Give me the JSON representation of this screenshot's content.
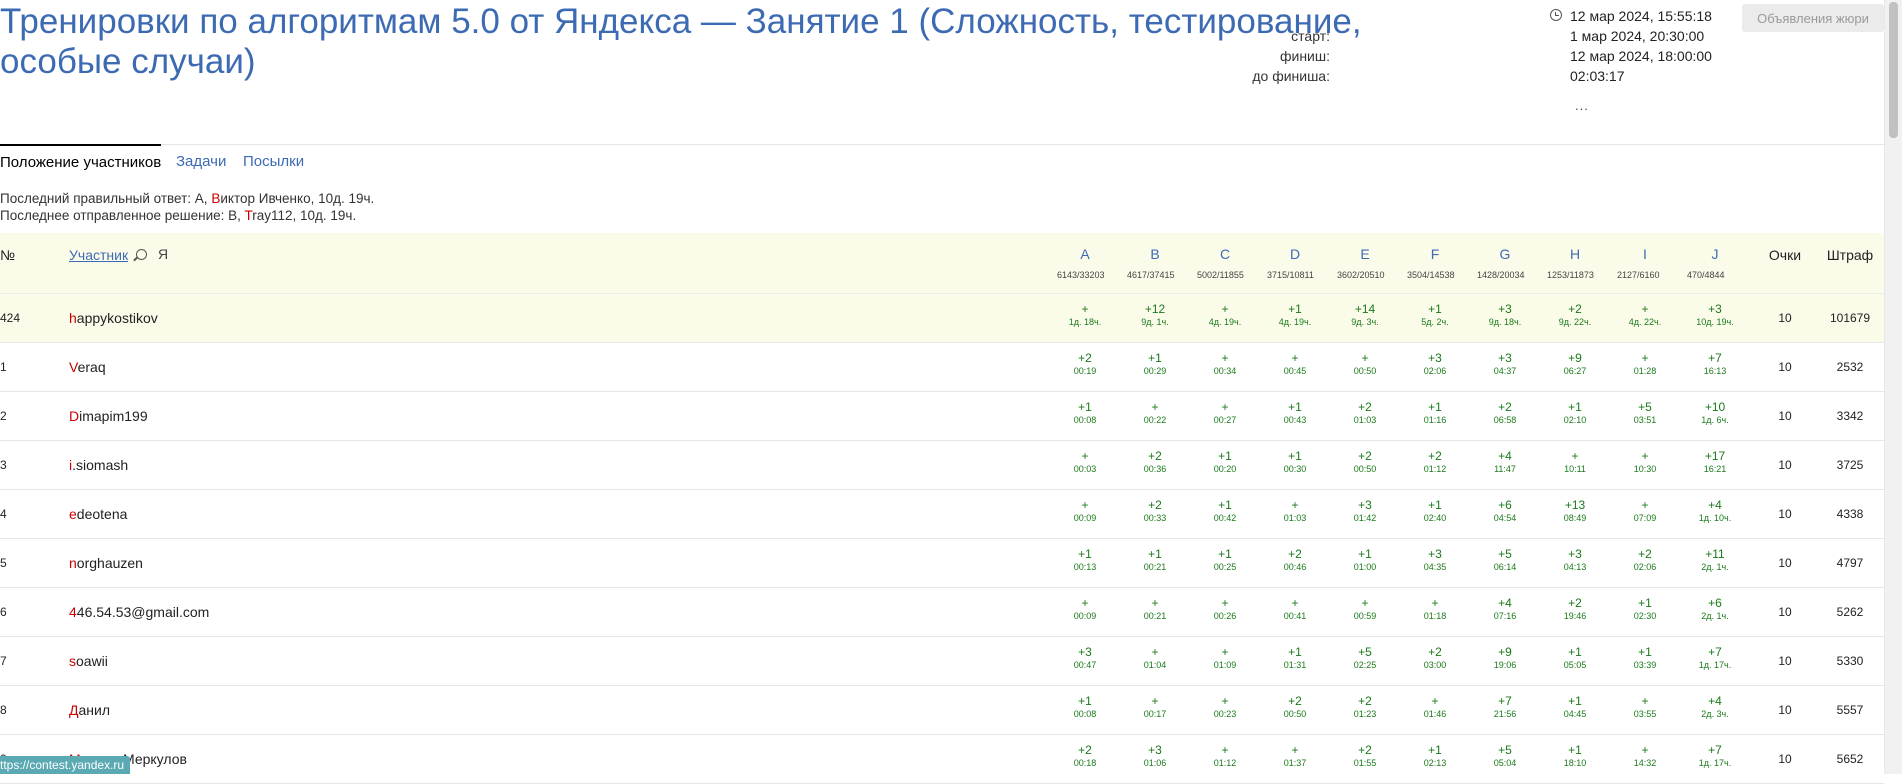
{
  "title": "Тренировки по алгоритмам 5.0 от Яндекса — Занятие 1 (Сложность, тестирование, особые случаи)",
  "meta": {
    "now": "12 мар 2024, 15:55:18",
    "start_label": "старт:",
    "start_value": "1 мар 2024, 20:30:00",
    "finish_label": "финиш:",
    "finish_value": "12 мар 2024, 18:00:00",
    "left_label": "до финиша:",
    "left_value": "02:03:17",
    "more": "..."
  },
  "announcements_button": "Объявления жюри",
  "tabs": [
    "Положение участников",
    "Задачи",
    "Посылки"
  ],
  "last_info": {
    "correct_label": "Последний правильный ответ:",
    "correct_problem": "A,",
    "correct_user_first": "В",
    "correct_user_rest": "иктор Ивченко,",
    "correct_time": "10д. 19ч.",
    "sent_label": "Последнее отправленное решение:",
    "sent_problem": "B,",
    "sent_user_first": "T",
    "sent_user_rest": "ray112,",
    "sent_time": "10д. 19ч."
  },
  "table": {
    "rank_header": "№",
    "name_header": "Участник",
    "me_label": "Я",
    "score_header": "Очки",
    "penalty_header": "Штраф",
    "problems": [
      {
        "letter": "A",
        "stat": "6143/33203"
      },
      {
        "letter": "B",
        "stat": "4617/37415"
      },
      {
        "letter": "C",
        "stat": "5002/11855"
      },
      {
        "letter": "D",
        "stat": "3715/10811"
      },
      {
        "letter": "E",
        "stat": "3602/20510"
      },
      {
        "letter": "F",
        "stat": "3504/14538"
      },
      {
        "letter": "G",
        "stat": "1428/20034"
      },
      {
        "letter": "H",
        "stat": "1253/11873"
      },
      {
        "letter": "I",
        "stat": "2127/6160"
      },
      {
        "letter": "J",
        "stat": "470/4844"
      }
    ],
    "rows": [
      {
        "rank": "424",
        "first": "h",
        "rest": "appykostikov",
        "score": "10",
        "penalty": "101679",
        "results": [
          [
            "+",
            "1д. 18ч."
          ],
          [
            "+12",
            "9д. 1ч."
          ],
          [
            "+",
            "4д. 19ч."
          ],
          [
            "+1",
            "4д. 19ч."
          ],
          [
            "+14",
            "9д. 3ч."
          ],
          [
            "+1",
            "5д. 2ч."
          ],
          [
            "+3",
            "9д. 18ч."
          ],
          [
            "+2",
            "9д. 22ч."
          ],
          [
            "+",
            "4д. 22ч."
          ],
          [
            "+3",
            "10д. 19ч."
          ]
        ]
      },
      {
        "rank": "1",
        "first": "V",
        "rest": "eraq",
        "score": "10",
        "penalty": "2532",
        "results": [
          [
            "+2",
            "00:19"
          ],
          [
            "+1",
            "00:29"
          ],
          [
            "+",
            "00:34"
          ],
          [
            "+",
            "00:45"
          ],
          [
            "+",
            "00:50"
          ],
          [
            "+3",
            "02:06"
          ],
          [
            "+3",
            "04:37"
          ],
          [
            "+9",
            "06:27"
          ],
          [
            "+",
            "01:28"
          ],
          [
            "+7",
            "16:13"
          ]
        ]
      },
      {
        "rank": "2",
        "first": "D",
        "rest": "imapim199",
        "score": "10",
        "penalty": "3342",
        "results": [
          [
            "+1",
            "00:08"
          ],
          [
            "+",
            "00:22"
          ],
          [
            "+",
            "00:27"
          ],
          [
            "+1",
            "00:43"
          ],
          [
            "+2",
            "01:03"
          ],
          [
            "+1",
            "01:16"
          ],
          [
            "+2",
            "06:58"
          ],
          [
            "+1",
            "02:10"
          ],
          [
            "+5",
            "03:51"
          ],
          [
            "+10",
            "1д. 6ч."
          ]
        ]
      },
      {
        "rank": "3",
        "first": "i",
        "rest": ".siomash",
        "score": "10",
        "penalty": "3725",
        "results": [
          [
            "+",
            "00:03"
          ],
          [
            "+2",
            "00:36"
          ],
          [
            "+1",
            "00:20"
          ],
          [
            "+1",
            "00:30"
          ],
          [
            "+2",
            "00:50"
          ],
          [
            "+2",
            "01:12"
          ],
          [
            "+4",
            "11:47"
          ],
          [
            "+",
            "10:11"
          ],
          [
            "+",
            "10:30"
          ],
          [
            "+17",
            "16:21"
          ]
        ]
      },
      {
        "rank": "4",
        "first": "e",
        "rest": "deotena",
        "score": "10",
        "penalty": "4338",
        "results": [
          [
            "+",
            "00:09"
          ],
          [
            "+2",
            "00:33"
          ],
          [
            "+1",
            "00:42"
          ],
          [
            "+",
            "01:03"
          ],
          [
            "+3",
            "01:42"
          ],
          [
            "+1",
            "02:40"
          ],
          [
            "+6",
            "04:54"
          ],
          [
            "+13",
            "08:49"
          ],
          [
            "+",
            "07:09"
          ],
          [
            "+4",
            "1д. 10ч."
          ]
        ]
      },
      {
        "rank": "5",
        "first": "n",
        "rest": "orghauzen",
        "score": "10",
        "penalty": "4797",
        "results": [
          [
            "+1",
            "00:13"
          ],
          [
            "+1",
            "00:21"
          ],
          [
            "+1",
            "00:25"
          ],
          [
            "+2",
            "00:46"
          ],
          [
            "+1",
            "01:00"
          ],
          [
            "+3",
            "04:35"
          ],
          [
            "+5",
            "06:14"
          ],
          [
            "+3",
            "04:13"
          ],
          [
            "+2",
            "02:06"
          ],
          [
            "+11",
            "2д. 1ч."
          ]
        ]
      },
      {
        "rank": "6",
        "first": "4",
        "rest": "46.54.53@gmail.com",
        "score": "10",
        "penalty": "5262",
        "results": [
          [
            "+",
            "00:09"
          ],
          [
            "+",
            "00:21"
          ],
          [
            "+",
            "00:26"
          ],
          [
            "+",
            "00:41"
          ],
          [
            "+",
            "00:59"
          ],
          [
            "+",
            "01:18"
          ],
          [
            "+4",
            "07:16"
          ],
          [
            "+2",
            "19:46"
          ],
          [
            "+1",
            "02:30"
          ],
          [
            "+6",
            "2д. 1ч."
          ]
        ]
      },
      {
        "rank": "7",
        "first": "s",
        "rest": "oawii",
        "score": "10",
        "penalty": "5330",
        "results": [
          [
            "+3",
            "00:47"
          ],
          [
            "+",
            "01:04"
          ],
          [
            "+",
            "01:09"
          ],
          [
            "+1",
            "01:31"
          ],
          [
            "+5",
            "02:25"
          ],
          [
            "+2",
            "03:00"
          ],
          [
            "+9",
            "19:06"
          ],
          [
            "+1",
            "05:05"
          ],
          [
            "+1",
            "03:39"
          ],
          [
            "+7",
            "1д. 17ч."
          ]
        ]
      },
      {
        "rank": "8",
        "first": "Д",
        "rest": "анил",
        "score": "10",
        "penalty": "5557",
        "results": [
          [
            "+1",
            "00:08"
          ],
          [
            "+",
            "00:17"
          ],
          [
            "+",
            "00:23"
          ],
          [
            "+2",
            "00:50"
          ],
          [
            "+2",
            "01:23"
          ],
          [
            "+",
            "01:46"
          ],
          [
            "+7",
            "21:56"
          ],
          [
            "+1",
            "04:45"
          ],
          [
            "+",
            "03:55"
          ],
          [
            "+4",
            "2д. 3ч."
          ]
        ]
      },
      {
        "rank": "9",
        "first": "М",
        "rest": "ихаил Меркулов",
        "score": "10",
        "penalty": "5652",
        "results": [
          [
            "+2",
            "00:18"
          ],
          [
            "+3",
            "01:06"
          ],
          [
            "+",
            "01:12"
          ],
          [
            "+",
            "01:37"
          ],
          [
            "+2",
            "01:55"
          ],
          [
            "+1",
            "02:13"
          ],
          [
            "+5",
            "05:04"
          ],
          [
            "+1",
            "18:10"
          ],
          [
            "+",
            "14:32"
          ],
          [
            "+7",
            "1д. 17ч."
          ]
        ]
      }
    ]
  },
  "status_url": "ttps://contest.yandex.ru"
}
